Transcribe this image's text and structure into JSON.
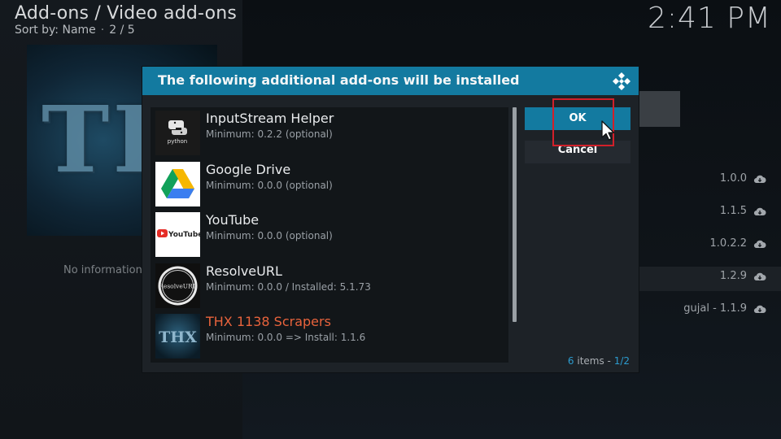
{
  "header": {
    "breadcrumb": "Add-ons / Video add-ons",
    "sort_label": "Sort by: Name",
    "sort_separator": "·",
    "page_position": "2 / 5",
    "clock": "2:41 PM"
  },
  "poster": {
    "text": "THX"
  },
  "info": {
    "no_info_text": "No information a"
  },
  "versions": [
    {
      "label": "1.0.0"
    },
    {
      "label": "1.1.5"
    },
    {
      "label": "1.0.2.2"
    },
    {
      "label": "1.2.9"
    },
    {
      "label": "gujal - 1.1.9"
    }
  ],
  "dialog": {
    "title": "The following additional add-ons will be installed",
    "items": [
      {
        "name": "InputStream Helper",
        "detail": "Minimum: 0.2.2 (optional)",
        "icon": "python-logo-icon"
      },
      {
        "name": "Google Drive",
        "detail": "Minimum: 0.0.0 (optional)",
        "icon": "google-drive-icon"
      },
      {
        "name": "YouTube",
        "detail": "Minimum: 0.0.0 (optional)",
        "icon": "youtube-logo-icon"
      },
      {
        "name": "ResolveURL",
        "detail": "Minimum: 0.0.0 / Installed: 5.1.73",
        "icon": "resolveurl-logo-icon"
      },
      {
        "name": "THX 1138 Scrapers",
        "detail": "Minimum: 0.0.0 => Install: 1.1.6",
        "icon": "thx-logo-icon"
      }
    ],
    "ok_label": "OK",
    "cancel_label": "Cancel",
    "item_count_num": "6",
    "item_count_text": " items - ",
    "page_num": "1/2",
    "thumb_texts": {
      "python": "python",
      "youtube": "YouTube",
      "resolve": "ResolveURL",
      "thx": "THX"
    }
  },
  "colors": {
    "accent": "#137aa0",
    "highlight": "#e8633c",
    "annotation": "#d2202a"
  }
}
